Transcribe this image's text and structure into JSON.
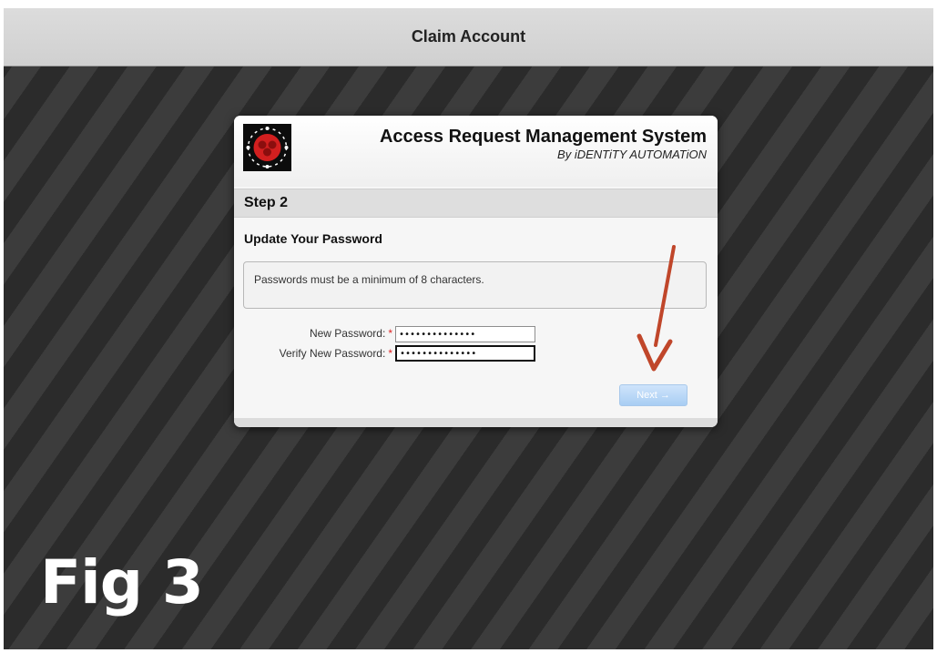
{
  "window": {
    "title": "Claim Account"
  },
  "brand": {
    "title": "Access Request Management System",
    "subtitle": "By iDENTiTY AUTOMATiON",
    "logo_icon": "logo-icon"
  },
  "step": {
    "label": "Step 2"
  },
  "section": {
    "title": "Update Your Password",
    "notice": "Passwords must be a minimum of 8 characters."
  },
  "form": {
    "new_password_label": "New Password:",
    "verify_password_label": "Verify New Password:",
    "required_marker": "*",
    "new_password_value": "••••••••••••••",
    "verify_password_value": "••••••••••••••"
  },
  "actions": {
    "next_label": "Next",
    "next_icon": "arrow-right-icon",
    "next_arrow_glyph": "→"
  },
  "annotation": {
    "figure_label": "Fig 3",
    "arrow_color": "#c0462a"
  },
  "colors": {
    "titlebar": "#d4d4d4",
    "background_dark": "#333333",
    "button_disabled": "#a8cdf3"
  }
}
